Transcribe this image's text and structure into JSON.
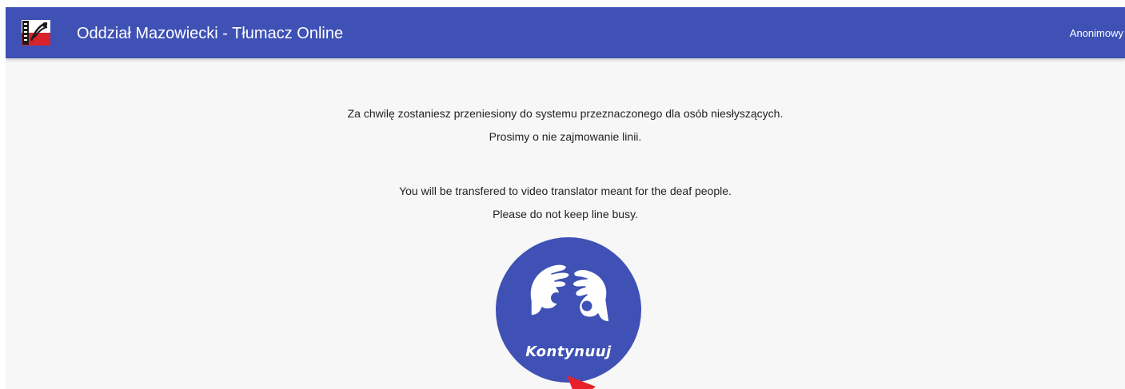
{
  "header": {
    "title": "Oddział Mazowiecki - Tłumacz Online",
    "user": "Anonimowy",
    "logo_icon": "pzg-logo-icon",
    "color": "#3f51b5"
  },
  "main": {
    "messages_pl": [
      "Za chwilę zostaniesz przeniesiony do systemu przeznaczonego dla osób niesłyszących.",
      "Prosimy o nie zajmowanie linii."
    ],
    "messages_en": [
      "You will be transfered to video translator meant for the deaf people.",
      "Please do not keep line busy."
    ],
    "continue_button": {
      "label": "Kontynuuj",
      "icon": "sign-language-hands-icon",
      "color": "#3f51b5"
    },
    "pointer": {
      "icon": "red-arrow-icon",
      "color": "#e8202a"
    }
  }
}
